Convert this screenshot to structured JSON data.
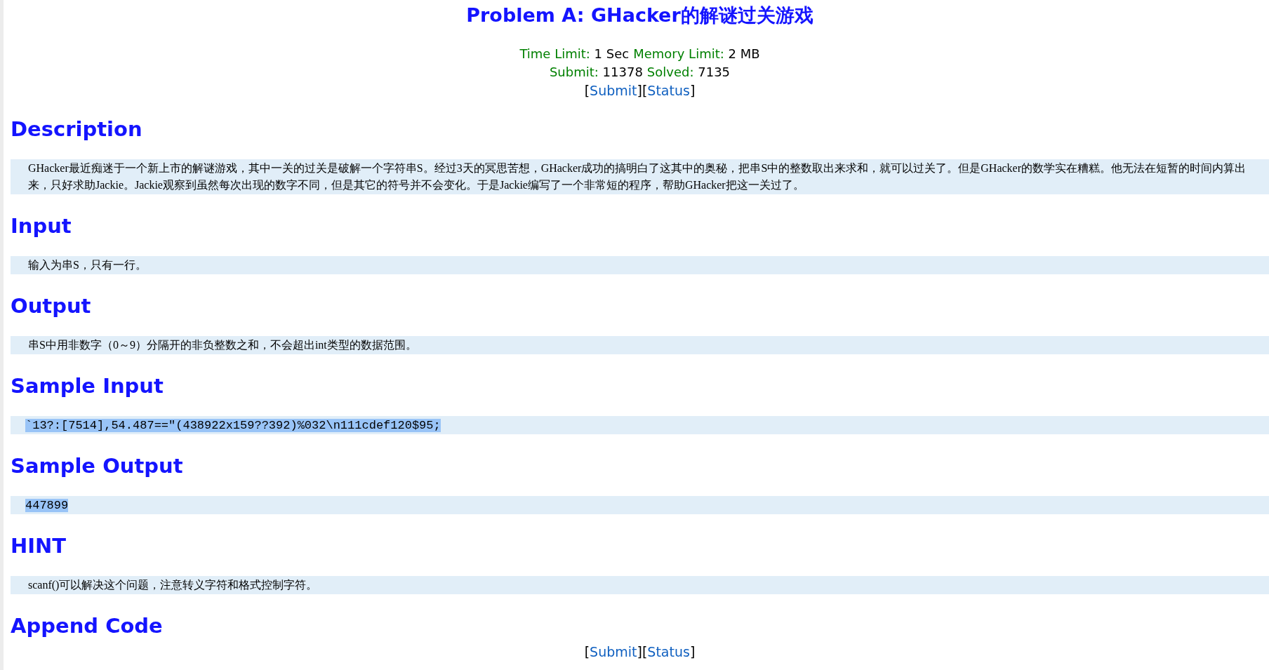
{
  "title": "Problem A: GHacker的解谜过关游戏",
  "limits": [
    {
      "label": "Time Limit:",
      "value": "1 Sec"
    },
    {
      "label": "Memory Limit:",
      "value": "2 MB"
    }
  ],
  "stats": [
    {
      "label": "Submit:",
      "value": "11378"
    },
    {
      "label": "Solved:",
      "value": "7135"
    }
  ],
  "top_links": [
    {
      "open": "[",
      "label": "Submit",
      "close": "]"
    },
    {
      "open": "[",
      "label": "Status",
      "close": "]"
    }
  ],
  "sections": [
    {
      "heading": "Description",
      "kind": "text",
      "content": "GHacker最近痴迷于一个新上市的解谜游戏，其中一关的过关是破解一个字符串S。经过3天的冥思苦想，GHacker成功的搞明白了这其中的奥秘，把串S中的整数取出来求和，就可以过关了。但是GHacker的数学实在糟糕。他无法在短暂的时间内算出来，只好求助Jackie。Jackie观察到虽然每次出现的数字不同，但是其它的符号并不会变化。于是Jackie编写了一个非常短的程序，帮助GHacker把这一关过了。"
    },
    {
      "heading": "Input",
      "kind": "text",
      "content": "输入为串S，只有一行。"
    },
    {
      "heading": "Output",
      "kind": "text",
      "content": "串S中用非数字（0～9）分隔开的非负整数之和，不会超出int类型的数据范围。"
    },
    {
      "heading": "Sample Input",
      "kind": "code",
      "content": "`13?:[7514],54.487==\"(438922x159??392)%032\\n111cdef120$95;",
      "selected": true
    },
    {
      "heading": "Sample Output",
      "kind": "code",
      "content": "447899",
      "selected": true
    },
    {
      "heading": "HINT",
      "kind": "text",
      "content": "scanf()可以解决这个问题，注意转义字符和格式控制字符。"
    },
    {
      "heading": "Append Code",
      "kind": "none"
    }
  ],
  "bottom_links": [
    {
      "open": "[",
      "label": "Submit",
      "close": "]"
    },
    {
      "open": "[",
      "label": "Status",
      "close": "]"
    }
  ]
}
